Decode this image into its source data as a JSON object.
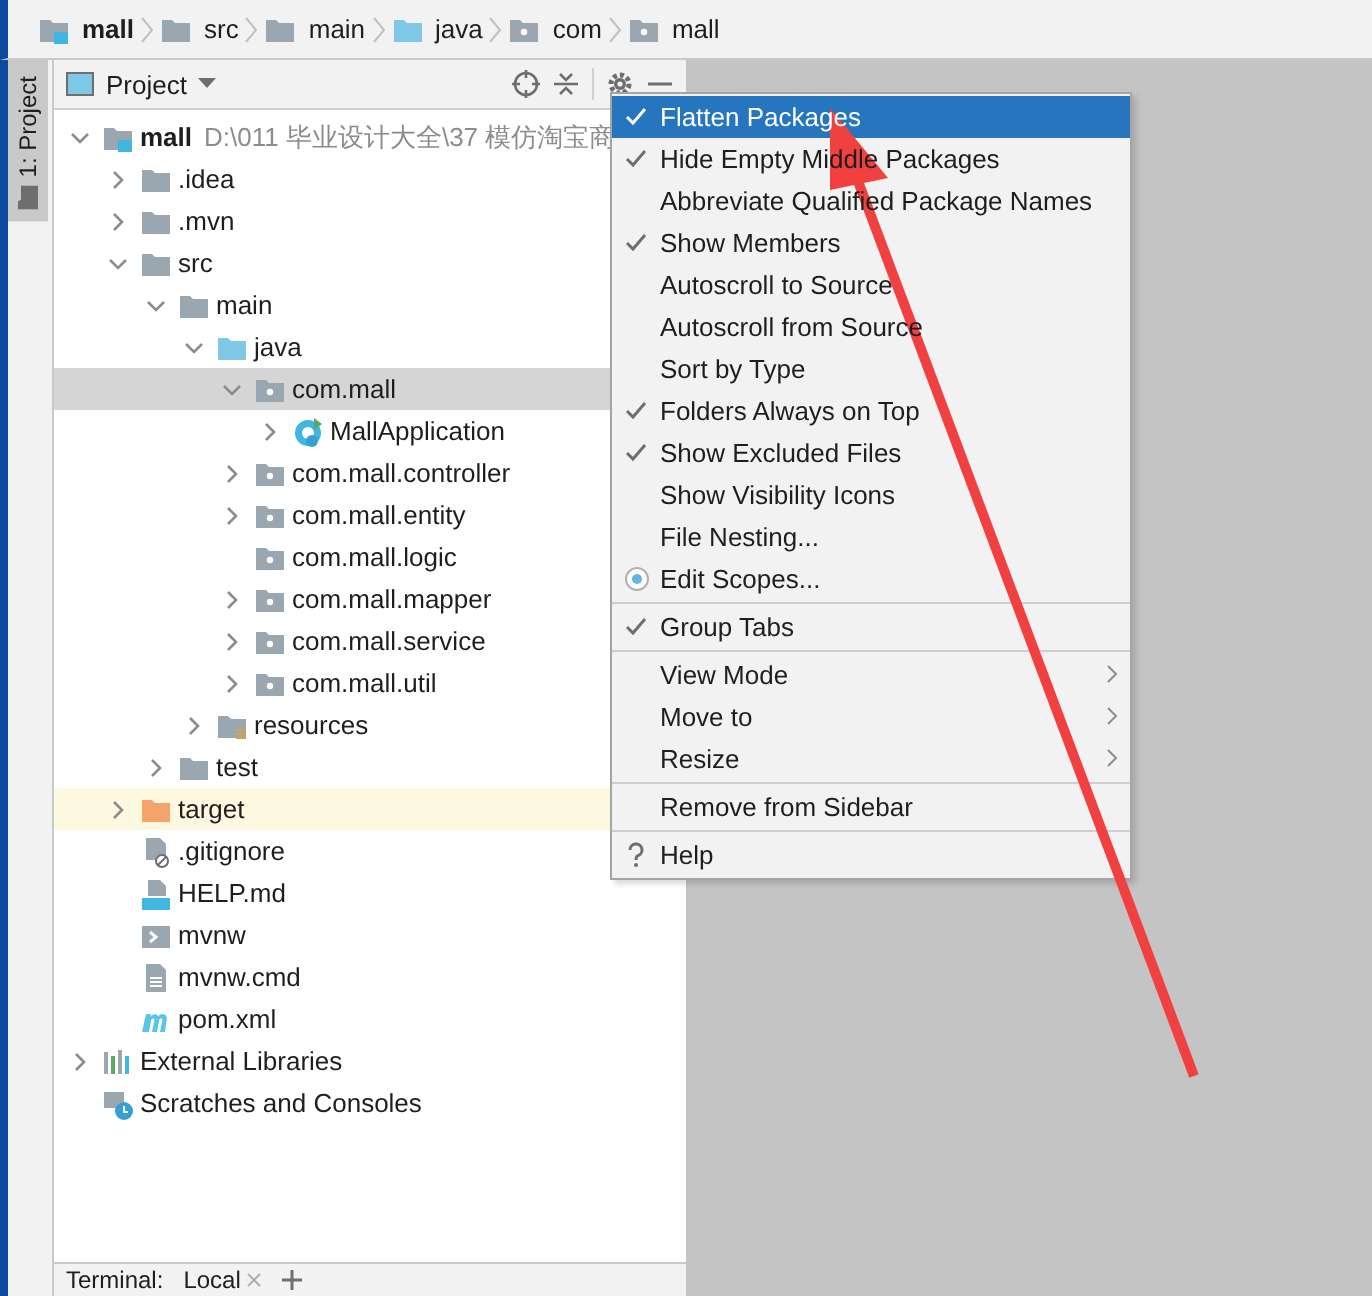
{
  "breadcrumb": [
    {
      "label": "mall",
      "kind": "module"
    },
    {
      "label": "src",
      "kind": "folder"
    },
    {
      "label": "main",
      "kind": "folder"
    },
    {
      "label": "java",
      "kind": "source-folder"
    },
    {
      "label": "com",
      "kind": "package"
    },
    {
      "label": "mall",
      "kind": "package"
    }
  ],
  "tool_strip": {
    "tabs": [
      {
        "label": "1: Project",
        "selected": true
      }
    ]
  },
  "panel": {
    "title": "Project"
  },
  "tree": [
    {
      "label": "mall",
      "path": "D:\\011 毕业设计大全\\37 模仿淘宝商",
      "kind": "module",
      "expanded": true,
      "selected": false,
      "highlighted": false,
      "children": [
        {
          "label": ".idea",
          "kind": "folder",
          "expanded": false,
          "selected": false,
          "highlighted": false
        },
        {
          "label": ".mvn",
          "kind": "folder",
          "expanded": false,
          "selected": false,
          "highlighted": false
        },
        {
          "label": "src",
          "kind": "folder",
          "expanded": true,
          "selected": false,
          "highlighted": false,
          "children": [
            {
              "label": "main",
              "kind": "folder",
              "expanded": true,
              "selected": false,
              "highlighted": false,
              "children": [
                {
                  "label": "java",
                  "kind": "source-folder",
                  "expanded": true,
                  "selected": false,
                  "highlighted": false,
                  "children": [
                    {
                      "label": "com.mall",
                      "kind": "package",
                      "expanded": true,
                      "selected": true,
                      "highlighted": false,
                      "children": [
                        {
                          "label": "MallApplication",
                          "kind": "class",
                          "expanded": false,
                          "selected": false,
                          "highlighted": false
                        }
                      ]
                    },
                    {
                      "label": "com.mall.controller",
                      "kind": "package",
                      "expanded": false,
                      "selected": false,
                      "highlighted": false
                    },
                    {
                      "label": "com.mall.entity",
                      "kind": "package",
                      "expanded": false,
                      "selected": false,
                      "highlighted": false
                    },
                    {
                      "label": "com.mall.logic",
                      "kind": "package",
                      "selected": false,
                      "highlighted": false
                    },
                    {
                      "label": "com.mall.mapper",
                      "kind": "package",
                      "expanded": false,
                      "selected": false,
                      "highlighted": false
                    },
                    {
                      "label": "com.mall.service",
                      "kind": "package",
                      "expanded": false,
                      "selected": false,
                      "highlighted": false
                    },
                    {
                      "label": "com.mall.util",
                      "kind": "package",
                      "expanded": false,
                      "selected": false,
                      "highlighted": false
                    }
                  ]
                },
                {
                  "label": "resources",
                  "kind": "resources-folder",
                  "expanded": false,
                  "selected": false,
                  "highlighted": false
                }
              ]
            },
            {
              "label": "test",
              "kind": "folder",
              "expanded": false,
              "selected": false,
              "highlighted": false
            }
          ]
        },
        {
          "label": "target",
          "kind": "excluded-folder",
          "expanded": false,
          "selected": false,
          "highlighted": true
        },
        {
          "label": ".gitignore",
          "kind": "ignore-file",
          "selected": false,
          "highlighted": false
        },
        {
          "label": "HELP.md",
          "kind": "markdown",
          "selected": false,
          "highlighted": false
        },
        {
          "label": "mvnw",
          "kind": "script",
          "selected": false,
          "highlighted": false
        },
        {
          "label": "mvnw.cmd",
          "kind": "text-file",
          "selected": false,
          "highlighted": false
        },
        {
          "label": "pom.xml",
          "kind": "maven",
          "selected": false,
          "highlighted": false
        }
      ]
    },
    {
      "label": "External Libraries",
      "kind": "libraries",
      "expanded": false,
      "selected": false,
      "highlighted": false
    },
    {
      "label": "Scratches and Consoles",
      "kind": "scratches",
      "selected": false,
      "highlighted": false
    }
  ],
  "menu": [
    {
      "kind": "check",
      "label": "Flatten Packages",
      "checked": true,
      "selected": true
    },
    {
      "kind": "check",
      "label": "Hide Empty Middle Packages",
      "checked": true,
      "selected": false
    },
    {
      "kind": "check",
      "label": "Abbreviate Qualified Package Names",
      "checked": false,
      "selected": false
    },
    {
      "kind": "check",
      "label": "Show Members",
      "checked": true,
      "selected": false
    },
    {
      "kind": "check",
      "label": "Autoscroll to Source",
      "checked": false,
      "selected": false
    },
    {
      "kind": "check",
      "label": "Autoscroll from Source",
      "checked": false,
      "selected": false
    },
    {
      "kind": "check",
      "label": "Sort by Type",
      "checked": false,
      "selected": false
    },
    {
      "kind": "check",
      "label": "Folders Always on Top",
      "checked": true,
      "selected": false
    },
    {
      "kind": "check",
      "label": "Show Excluded Files",
      "checked": true,
      "selected": false
    },
    {
      "kind": "check",
      "label": "Show Visibility Icons",
      "checked": false,
      "selected": false
    },
    {
      "kind": "plain",
      "label": "File Nesting...",
      "selected": false
    },
    {
      "kind": "scope",
      "label": "Edit Scopes...",
      "selected": false
    },
    {
      "kind": "separator"
    },
    {
      "kind": "check",
      "label": "Group Tabs",
      "checked": true,
      "selected": false
    },
    {
      "kind": "separator"
    },
    {
      "kind": "submenu",
      "label": "View Mode",
      "selected": false
    },
    {
      "kind": "submenu",
      "label": "Move to",
      "selected": false
    },
    {
      "kind": "submenu",
      "label": "Resize",
      "selected": false
    },
    {
      "kind": "separator"
    },
    {
      "kind": "plain",
      "label": "Remove from Sidebar",
      "selected": false
    },
    {
      "kind": "separator"
    },
    {
      "kind": "help",
      "label": "Help",
      "selected": false
    }
  ],
  "bottom_bar": {
    "label": "Terminal:",
    "tabs": [
      {
        "label": "Local",
        "selected": true
      }
    ]
  }
}
